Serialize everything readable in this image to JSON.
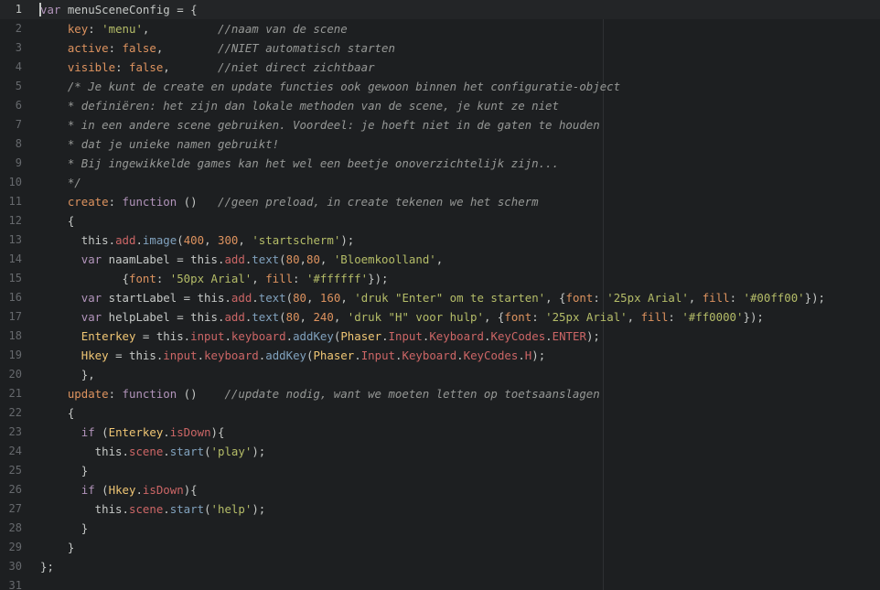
{
  "colors": {
    "background": "#1d1f21",
    "text": "#c5c8c6",
    "line_number": "#66696d",
    "keyword": "#b294bb",
    "property": "#de935f",
    "string": "#b5bd68",
    "number": "#de935f",
    "comment": "#969896",
    "member": "#cc6666",
    "function": "#81a2be",
    "variable": "#f0c674"
  },
  "editor": {
    "current_line": 1,
    "lines": [
      {
        "n": "1",
        "t": [
          [
            "kw",
            "var"
          ],
          [
            "plain",
            " menuSceneConfig = {"
          ]
        ]
      },
      {
        "n": "2",
        "t": [
          [
            "plain",
            "    "
          ],
          [
            "prop",
            "key"
          ],
          [
            "plain",
            ": "
          ],
          [
            "str",
            "'menu'"
          ],
          [
            "plain",
            ",          "
          ],
          [
            "com",
            "//naam van de scene"
          ]
        ]
      },
      {
        "n": "3",
        "t": [
          [
            "plain",
            "    "
          ],
          [
            "prop",
            "active"
          ],
          [
            "plain",
            ": "
          ],
          [
            "prop",
            "false"
          ],
          [
            "plain",
            ",        "
          ],
          [
            "com",
            "//NIET automatisch starten"
          ]
        ]
      },
      {
        "n": "4",
        "t": [
          [
            "plain",
            "    "
          ],
          [
            "prop",
            "visible"
          ],
          [
            "plain",
            ": "
          ],
          [
            "prop",
            "false"
          ],
          [
            "plain",
            ",       "
          ],
          [
            "com",
            "//niet direct zichtbaar"
          ]
        ]
      },
      {
        "n": "5",
        "t": [
          [
            "plain",
            "    "
          ],
          [
            "com",
            "/* Je kunt de create en update functies ook gewoon binnen het configuratie-object"
          ]
        ]
      },
      {
        "n": "6",
        "t": [
          [
            "plain",
            "    "
          ],
          [
            "com",
            "* definiëren: het zijn dan lokale methoden van de scene, je kunt ze niet"
          ]
        ]
      },
      {
        "n": "7",
        "t": [
          [
            "plain",
            "    "
          ],
          [
            "com",
            "* in een andere scene gebruiken. Voordeel: je hoeft niet in de gaten te houden"
          ]
        ]
      },
      {
        "n": "8",
        "t": [
          [
            "plain",
            "    "
          ],
          [
            "com",
            "* dat je unieke namen gebruikt!"
          ]
        ]
      },
      {
        "n": "9",
        "t": [
          [
            "plain",
            "    "
          ],
          [
            "com",
            "* Bij ingewikkelde games kan het wel een beetje onoverzichtelijk zijn..."
          ]
        ]
      },
      {
        "n": "10",
        "t": [
          [
            "plain",
            "    "
          ],
          [
            "com",
            "*/"
          ]
        ]
      },
      {
        "n": "11",
        "t": [
          [
            "plain",
            "    "
          ],
          [
            "prop",
            "create"
          ],
          [
            "plain",
            ": "
          ],
          [
            "kw",
            "function"
          ],
          [
            "plain",
            " ()   "
          ],
          [
            "com",
            "//geen preload, in create tekenen we het scherm"
          ]
        ]
      },
      {
        "n": "12",
        "t": [
          [
            "plain",
            "    {"
          ]
        ]
      },
      {
        "n": "13",
        "t": [
          [
            "plain",
            "      this."
          ],
          [
            "mem",
            "add"
          ],
          [
            "plain",
            "."
          ],
          [
            "fn",
            "image"
          ],
          [
            "plain",
            "("
          ],
          [
            "num",
            "400"
          ],
          [
            "plain",
            ", "
          ],
          [
            "num",
            "300"
          ],
          [
            "plain",
            ", "
          ],
          [
            "str",
            "'startscherm'"
          ],
          [
            "plain",
            ");"
          ]
        ]
      },
      {
        "n": "14",
        "t": [
          [
            "plain",
            "      "
          ],
          [
            "kw",
            "var"
          ],
          [
            "plain",
            " naamLabel = this."
          ],
          [
            "mem",
            "add"
          ],
          [
            "plain",
            "."
          ],
          [
            "fn",
            "text"
          ],
          [
            "plain",
            "("
          ],
          [
            "num",
            "80"
          ],
          [
            "plain",
            ","
          ],
          [
            "num",
            "80"
          ],
          [
            "plain",
            ", "
          ],
          [
            "str",
            "'Bloemkoolland'"
          ],
          [
            "plain",
            ","
          ]
        ]
      },
      {
        "n": "15",
        "t": [
          [
            "plain",
            "            {"
          ],
          [
            "prop",
            "font"
          ],
          [
            "plain",
            ": "
          ],
          [
            "str",
            "'50px Arial'"
          ],
          [
            "plain",
            ", "
          ],
          [
            "prop",
            "fill"
          ],
          [
            "plain",
            ": "
          ],
          [
            "str",
            "'#ffffff'"
          ],
          [
            "plain",
            "});"
          ]
        ]
      },
      {
        "n": "16",
        "t": [
          [
            "plain",
            "      "
          ],
          [
            "kw",
            "var"
          ],
          [
            "plain",
            " startLabel = this."
          ],
          [
            "mem",
            "add"
          ],
          [
            "plain",
            "."
          ],
          [
            "fn",
            "text"
          ],
          [
            "plain",
            "("
          ],
          [
            "num",
            "80"
          ],
          [
            "plain",
            ", "
          ],
          [
            "num",
            "160"
          ],
          [
            "plain",
            ", "
          ],
          [
            "str",
            "'druk \"Enter\" om te starten'"
          ],
          [
            "plain",
            ", {"
          ],
          [
            "prop",
            "font"
          ],
          [
            "plain",
            ": "
          ],
          [
            "str",
            "'25px Arial'"
          ],
          [
            "plain",
            ", "
          ],
          [
            "prop",
            "fill"
          ],
          [
            "plain",
            ": "
          ],
          [
            "str",
            "'#00ff00'"
          ],
          [
            "plain",
            "});"
          ]
        ]
      },
      {
        "n": "17",
        "t": [
          [
            "plain",
            "      "
          ],
          [
            "kw",
            "var"
          ],
          [
            "plain",
            " helpLabel = this."
          ],
          [
            "mem",
            "add"
          ],
          [
            "plain",
            "."
          ],
          [
            "fn",
            "text"
          ],
          [
            "plain",
            "("
          ],
          [
            "num",
            "80"
          ],
          [
            "plain",
            ", "
          ],
          [
            "num",
            "240"
          ],
          [
            "plain",
            ", "
          ],
          [
            "str",
            "'druk \"H\" voor hulp'"
          ],
          [
            "plain",
            ", {"
          ],
          [
            "prop",
            "font"
          ],
          [
            "plain",
            ": "
          ],
          [
            "str",
            "'25px Arial'"
          ],
          [
            "plain",
            ", "
          ],
          [
            "prop",
            "fill"
          ],
          [
            "plain",
            ": "
          ],
          [
            "str",
            "'#ff0000'"
          ],
          [
            "plain",
            "});"
          ]
        ]
      },
      {
        "n": "18",
        "t": [
          [
            "plain",
            "      "
          ],
          [
            "var",
            "Enterkey"
          ],
          [
            "plain",
            " = this."
          ],
          [
            "mem",
            "input"
          ],
          [
            "plain",
            "."
          ],
          [
            "mem",
            "keyboard"
          ],
          [
            "plain",
            "."
          ],
          [
            "fn",
            "addKey"
          ],
          [
            "plain",
            "("
          ],
          [
            "var",
            "Phaser"
          ],
          [
            "plain",
            "."
          ],
          [
            "mem",
            "Input"
          ],
          [
            "plain",
            "."
          ],
          [
            "mem",
            "Keyboard"
          ],
          [
            "plain",
            "."
          ],
          [
            "mem",
            "KeyCodes"
          ],
          [
            "plain",
            "."
          ],
          [
            "mem",
            "ENTER"
          ],
          [
            "plain",
            ");"
          ]
        ]
      },
      {
        "n": "19",
        "t": [
          [
            "plain",
            "      "
          ],
          [
            "var",
            "Hkey"
          ],
          [
            "plain",
            " = this."
          ],
          [
            "mem",
            "input"
          ],
          [
            "plain",
            "."
          ],
          [
            "mem",
            "keyboard"
          ],
          [
            "plain",
            "."
          ],
          [
            "fn",
            "addKey"
          ],
          [
            "plain",
            "("
          ],
          [
            "var",
            "Phaser"
          ],
          [
            "plain",
            "."
          ],
          [
            "mem",
            "Input"
          ],
          [
            "plain",
            "."
          ],
          [
            "mem",
            "Keyboard"
          ],
          [
            "plain",
            "."
          ],
          [
            "mem",
            "KeyCodes"
          ],
          [
            "plain",
            "."
          ],
          [
            "mem",
            "H"
          ],
          [
            "plain",
            ");"
          ]
        ]
      },
      {
        "n": "20",
        "t": [
          [
            "plain",
            "      },"
          ]
        ]
      },
      {
        "n": "21",
        "t": [
          [
            "plain",
            "    "
          ],
          [
            "prop",
            "update"
          ],
          [
            "plain",
            ": "
          ],
          [
            "kw",
            "function"
          ],
          [
            "plain",
            " ()    "
          ],
          [
            "com",
            "//update nodig, want we moeten letten op toetsaanslagen"
          ]
        ]
      },
      {
        "n": "22",
        "t": [
          [
            "plain",
            "    {"
          ]
        ]
      },
      {
        "n": "23",
        "t": [
          [
            "plain",
            "      "
          ],
          [
            "kw",
            "if"
          ],
          [
            "plain",
            " ("
          ],
          [
            "var",
            "Enterkey"
          ],
          [
            "plain",
            "."
          ],
          [
            "mem",
            "isDown"
          ],
          [
            "plain",
            "){"
          ]
        ]
      },
      {
        "n": "24",
        "t": [
          [
            "plain",
            "        this."
          ],
          [
            "mem",
            "scene"
          ],
          [
            "plain",
            "."
          ],
          [
            "fn",
            "start"
          ],
          [
            "plain",
            "("
          ],
          [
            "str",
            "'play'"
          ],
          [
            "plain",
            ");"
          ]
        ]
      },
      {
        "n": "25",
        "t": [
          [
            "plain",
            "      }"
          ]
        ]
      },
      {
        "n": "26",
        "t": [
          [
            "plain",
            "      "
          ],
          [
            "kw",
            "if"
          ],
          [
            "plain",
            " ("
          ],
          [
            "var",
            "Hkey"
          ],
          [
            "plain",
            "."
          ],
          [
            "mem",
            "isDown"
          ],
          [
            "plain",
            "){"
          ]
        ]
      },
      {
        "n": "27",
        "t": [
          [
            "plain",
            "        this."
          ],
          [
            "mem",
            "scene"
          ],
          [
            "plain",
            "."
          ],
          [
            "fn",
            "start"
          ],
          [
            "plain",
            "("
          ],
          [
            "str",
            "'help'"
          ],
          [
            "plain",
            ");"
          ]
        ]
      },
      {
        "n": "28",
        "t": [
          [
            "plain",
            "      }"
          ]
        ]
      },
      {
        "n": "29",
        "t": [
          [
            "plain",
            "    }"
          ]
        ]
      },
      {
        "n": "30",
        "t": [
          [
            "plain",
            "};"
          ]
        ]
      },
      {
        "n": "31",
        "t": []
      }
    ]
  }
}
